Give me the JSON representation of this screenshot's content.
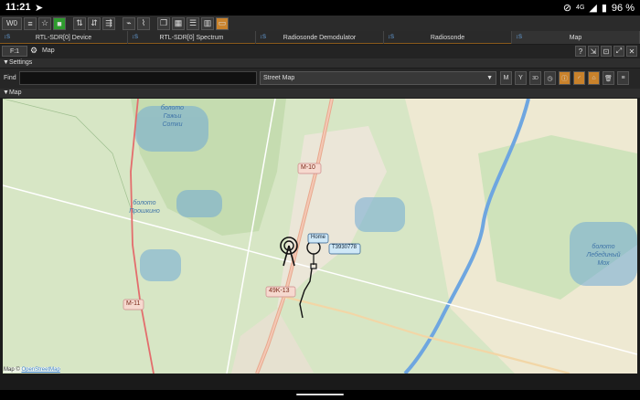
{
  "status": {
    "time": "11:21",
    "battery": "96 %",
    "network": "4G"
  },
  "toolbar": {
    "device_set": "W0"
  },
  "tabs": [
    {
      "label": "RTL-SDR[0] Device"
    },
    {
      "label": "RTL-SDR[0] Spectrum"
    },
    {
      "label": "Radiosonde Demodulator"
    },
    {
      "label": "Radiosonde"
    },
    {
      "label": "Map"
    }
  ],
  "window": {
    "feature_label": "F:1",
    "title": "Map"
  },
  "settings": {
    "label": "Settings"
  },
  "find": {
    "label": "Find",
    "value": ""
  },
  "map_type": {
    "selected": "Street Map"
  },
  "map_buttons": {
    "m": "M",
    "y": "Y",
    "three_d": "3D"
  },
  "map_section": {
    "label": "Map"
  },
  "map": {
    "roads": {
      "m10": "M-10",
      "m11": "M-11",
      "k13": "49K-13"
    },
    "places": {
      "swamp1": "болото",
      "swamp1b": "Гажьи",
      "swamp1c": "Сотки",
      "swamp2": "болото",
      "swamp2b": "Прошкино",
      "swamp3": "болото",
      "swamp3b": "Лебединый",
      "swamp3c": "Мох"
    },
    "markers": {
      "home": "Home",
      "sonde": "T3930778"
    },
    "attribution_prefix": "Map ©",
    "attribution_link": "OpenStreetMap"
  }
}
